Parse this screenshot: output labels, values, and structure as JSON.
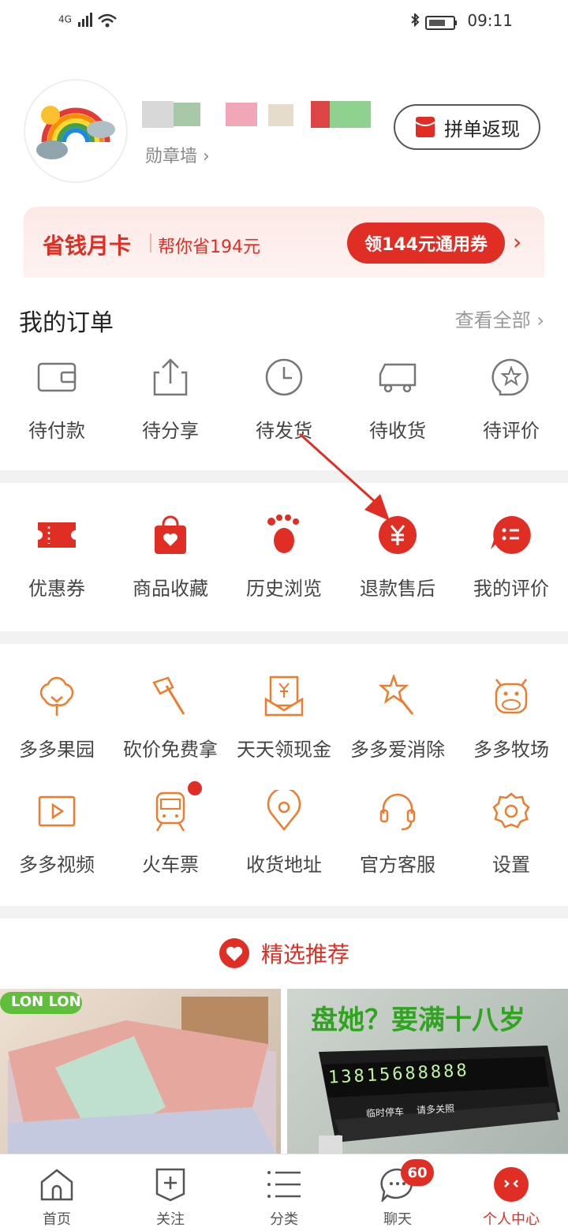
{
  "status_bar": {
    "network": "4G",
    "time": "09:11"
  },
  "header": {
    "badge_wall": "勋章墙",
    "pindan_button": "拼单返现",
    "savings_card": {
      "title": "省钱月卡",
      "subtitle": "帮你省194元",
      "coupon_button": "领144元通用券"
    }
  },
  "orders": {
    "title": "我的订单",
    "view_all": "查看全部",
    "items": [
      {
        "label": "待付款",
        "icon": "wallet-icon"
      },
      {
        "label": "待分享",
        "icon": "share-icon"
      },
      {
        "label": "待发货",
        "icon": "clock-icon"
      },
      {
        "label": "待收货",
        "icon": "truck-icon"
      },
      {
        "label": "待评价",
        "icon": "review-icon"
      }
    ]
  },
  "tools": {
    "items": [
      {
        "label": "优惠券",
        "icon": "coupon-icon"
      },
      {
        "label": "商品收藏",
        "icon": "favorite-bag-icon"
      },
      {
        "label": "历史浏览",
        "icon": "footprint-icon"
      },
      {
        "label": "退款售后",
        "icon": "yuan-icon"
      },
      {
        "label": "我的评价",
        "icon": "comment-list-icon"
      }
    ]
  },
  "apps": {
    "row1": [
      {
        "label": "多多果园",
        "icon": "tree-icon"
      },
      {
        "label": "砍价免费拿",
        "icon": "axe-icon"
      },
      {
        "label": "天天领现金",
        "icon": "cash-envelope-icon"
      },
      {
        "label": "多多爱消除",
        "icon": "star-wand-icon"
      },
      {
        "label": "多多牧场",
        "icon": "cow-icon"
      }
    ],
    "row2": [
      {
        "label": "多多视频",
        "icon": "video-icon"
      },
      {
        "label": "火车票",
        "icon": "train-icon"
      },
      {
        "label": "收货地址",
        "icon": "location-icon"
      },
      {
        "label": "官方客服",
        "icon": "headset-icon"
      },
      {
        "label": "设置",
        "icon": "gear-icon"
      }
    ]
  },
  "recommend": {
    "title": "精选推荐",
    "products": [
      {
        "brand_tag": "LON LON"
      },
      {
        "headline": "盘她？要满十八岁",
        "plate": "13815688888",
        "caption_left": "临时停车",
        "caption_right": "请多关照"
      }
    ]
  },
  "bottom_nav": {
    "items": [
      {
        "label": "首页",
        "icon": "home-icon"
      },
      {
        "label": "关注",
        "icon": "follow-icon"
      },
      {
        "label": "分类",
        "icon": "category-icon"
      },
      {
        "label": "聊天",
        "icon": "chat-icon",
        "badge": "60"
      },
      {
        "label": "个人中心",
        "icon": "profile-icon",
        "active": true
      }
    ]
  },
  "colors": {
    "brand_red": "#e02e24",
    "app_orange": "#f07b2c"
  }
}
